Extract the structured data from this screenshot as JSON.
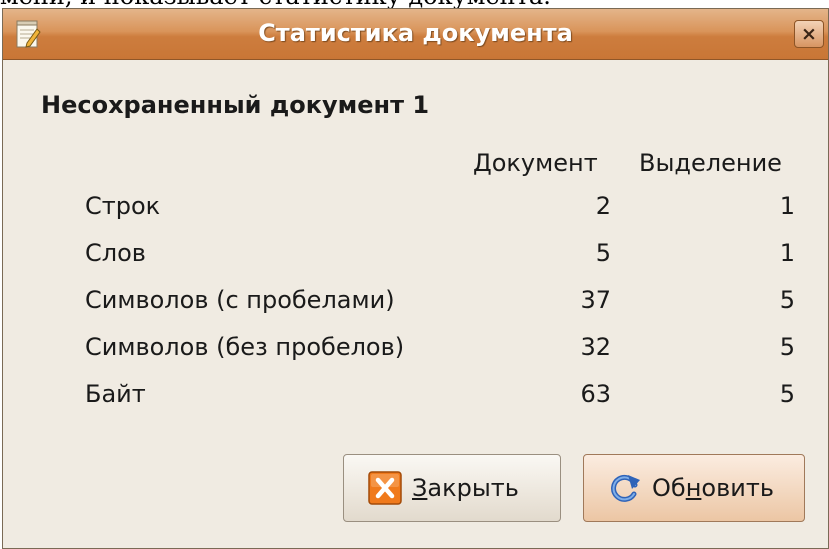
{
  "background_text": "мени, и показывает статистику документа.",
  "window": {
    "title": "Статистика документа",
    "close_glyph": "×"
  },
  "document_name": "Несохраненный документ 1",
  "columns": {
    "document": "Документ",
    "selection": "Выделение"
  },
  "rows": [
    {
      "label": "Строк",
      "document": "2",
      "selection": "1"
    },
    {
      "label": "Слов",
      "document": "5",
      "selection": "1"
    },
    {
      "label": "Символов (с пробелами)",
      "document": "37",
      "selection": "5"
    },
    {
      "label": "Символов (без пробелов)",
      "document": "32",
      "selection": "5"
    },
    {
      "label": "Байт",
      "document": "63",
      "selection": "5"
    }
  ],
  "buttons": {
    "close": {
      "mnemonic": "З",
      "rest": "акрыть",
      "icon": "close-x-icon"
    },
    "refresh": {
      "before": "Об",
      "mnemonic": "н",
      "after": "овить",
      "icon": "refresh-icon"
    }
  }
}
